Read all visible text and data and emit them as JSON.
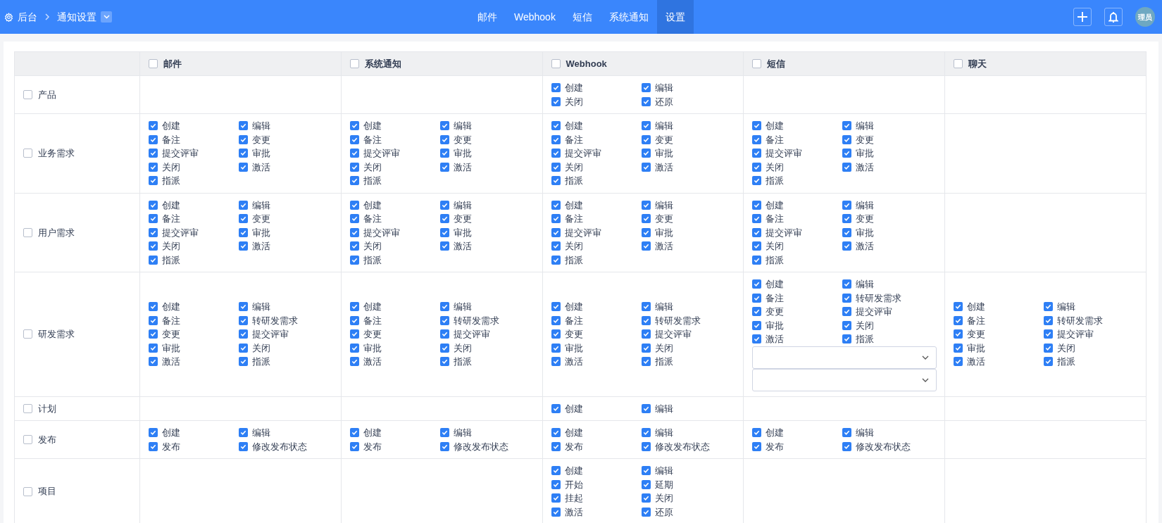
{
  "breadcrumb": {
    "root": "后台",
    "current": "通知设置"
  },
  "nav": [
    {
      "label": "邮件",
      "selected": false
    },
    {
      "label": "Webhook",
      "selected": false
    },
    {
      "label": "短信",
      "selected": false
    },
    {
      "label": "系统通知",
      "selected": false
    },
    {
      "label": "设置",
      "selected": true
    }
  ],
  "avatar": "理员",
  "table": {
    "columns": [
      {
        "label": "邮件",
        "checked": false
      },
      {
        "label": "系统通知",
        "checked": false
      },
      {
        "label": "Webhook",
        "checked": false
      },
      {
        "label": "短信",
        "checked": false
      },
      {
        "label": "聊天",
        "checked": false
      }
    ],
    "rows": [
      {
        "label": "产品",
        "checked": false,
        "cells": [
          {},
          {},
          {
            "items": [
              {
                "label": "创建",
                "checked": true
              },
              {
                "label": "编辑",
                "checked": true
              },
              {
                "label": "关闭",
                "checked": true
              },
              {
                "label": "还原",
                "checked": true
              }
            ]
          },
          {},
          {}
        ]
      },
      {
        "label": "业务需求",
        "checked": false,
        "cells": [
          {
            "items": [
              {
                "label": "创建",
                "checked": true
              },
              {
                "label": "编辑",
                "checked": true
              },
              {
                "label": "备注",
                "checked": true
              },
              {
                "label": "变更",
                "checked": true
              },
              {
                "label": "提交评审",
                "checked": true
              },
              {
                "label": "审批",
                "checked": true
              },
              {
                "label": "关闭",
                "checked": true
              },
              {
                "label": "激活",
                "checked": true
              },
              {
                "label": "指派",
                "checked": true
              }
            ]
          },
          {
            "items": [
              {
                "label": "创建",
                "checked": true
              },
              {
                "label": "编辑",
                "checked": true
              },
              {
                "label": "备注",
                "checked": true
              },
              {
                "label": "变更",
                "checked": true
              },
              {
                "label": "提交评审",
                "checked": true
              },
              {
                "label": "审批",
                "checked": true
              },
              {
                "label": "关闭",
                "checked": true
              },
              {
                "label": "激活",
                "checked": true
              },
              {
                "label": "指派",
                "checked": true
              }
            ]
          },
          {
            "items": [
              {
                "label": "创建",
                "checked": true
              },
              {
                "label": "编辑",
                "checked": true
              },
              {
                "label": "备注",
                "checked": true
              },
              {
                "label": "变更",
                "checked": true
              },
              {
                "label": "提交评审",
                "checked": true
              },
              {
                "label": "审批",
                "checked": true
              },
              {
                "label": "关闭",
                "checked": true
              },
              {
                "label": "激活",
                "checked": true
              },
              {
                "label": "指派",
                "checked": true
              }
            ]
          },
          {
            "items": [
              {
                "label": "创建",
                "checked": true
              },
              {
                "label": "编辑",
                "checked": true
              },
              {
                "label": "备注",
                "checked": true
              },
              {
                "label": "变更",
                "checked": true
              },
              {
                "label": "提交评审",
                "checked": true
              },
              {
                "label": "审批",
                "checked": true
              },
              {
                "label": "关闭",
                "checked": true
              },
              {
                "label": "激活",
                "checked": true
              },
              {
                "label": "指派",
                "checked": true
              }
            ]
          },
          {}
        ]
      },
      {
        "label": "用户需求",
        "checked": false,
        "cells": [
          {
            "items": [
              {
                "label": "创建",
                "checked": true
              },
              {
                "label": "编辑",
                "checked": true
              },
              {
                "label": "备注",
                "checked": true
              },
              {
                "label": "变更",
                "checked": true
              },
              {
                "label": "提交评审",
                "checked": true
              },
              {
                "label": "审批",
                "checked": true
              },
              {
                "label": "关闭",
                "checked": true
              },
              {
                "label": "激活",
                "checked": true
              },
              {
                "label": "指派",
                "checked": true
              }
            ]
          },
          {
            "items": [
              {
                "label": "创建",
                "checked": true
              },
              {
                "label": "编辑",
                "checked": true
              },
              {
                "label": "备注",
                "checked": true
              },
              {
                "label": "变更",
                "checked": true
              },
              {
                "label": "提交评审",
                "checked": true
              },
              {
                "label": "审批",
                "checked": true
              },
              {
                "label": "关闭",
                "checked": true
              },
              {
                "label": "激活",
                "checked": true
              },
              {
                "label": "指派",
                "checked": true
              }
            ]
          },
          {
            "items": [
              {
                "label": "创建",
                "checked": true
              },
              {
                "label": "编辑",
                "checked": true
              },
              {
                "label": "备注",
                "checked": true
              },
              {
                "label": "变更",
                "checked": true
              },
              {
                "label": "提交评审",
                "checked": true
              },
              {
                "label": "审批",
                "checked": true
              },
              {
                "label": "关闭",
                "checked": true
              },
              {
                "label": "激活",
                "checked": true
              },
              {
                "label": "指派",
                "checked": true
              }
            ]
          },
          {
            "items": [
              {
                "label": "创建",
                "checked": true
              },
              {
                "label": "编辑",
                "checked": true
              },
              {
                "label": "备注",
                "checked": true
              },
              {
                "label": "变更",
                "checked": true
              },
              {
                "label": "提交评审",
                "checked": true
              },
              {
                "label": "审批",
                "checked": true
              },
              {
                "label": "关闭",
                "checked": true
              },
              {
                "label": "激活",
                "checked": true
              },
              {
                "label": "指派",
                "checked": true
              }
            ]
          },
          {}
        ]
      },
      {
        "label": "研发需求",
        "checked": false,
        "cells": [
          {
            "items": [
              {
                "label": "创建",
                "checked": true
              },
              {
                "label": "编辑",
                "checked": true
              },
              {
                "label": "备注",
                "checked": true
              },
              {
                "label": "转研发需求",
                "checked": true
              },
              {
                "label": "变更",
                "checked": true
              },
              {
                "label": "提交评审",
                "checked": true
              },
              {
                "label": "审批",
                "checked": true
              },
              {
                "label": "关闭",
                "checked": true
              },
              {
                "label": "激活",
                "checked": true
              },
              {
                "label": "指派",
                "checked": true
              }
            ]
          },
          {
            "items": [
              {
                "label": "创建",
                "checked": true
              },
              {
                "label": "编辑",
                "checked": true
              },
              {
                "label": "备注",
                "checked": true
              },
              {
                "label": "转研发需求",
                "checked": true
              },
              {
                "label": "变更",
                "checked": true
              },
              {
                "label": "提交评审",
                "checked": true
              },
              {
                "label": "审批",
                "checked": true
              },
              {
                "label": "关闭",
                "checked": true
              },
              {
                "label": "激活",
                "checked": true
              },
              {
                "label": "指派",
                "checked": true
              }
            ]
          },
          {
            "items": [
              {
                "label": "创建",
                "checked": true
              },
              {
                "label": "编辑",
                "checked": true
              },
              {
                "label": "备注",
                "checked": true
              },
              {
                "label": "转研发需求",
                "checked": true
              },
              {
                "label": "变更",
                "checked": true
              },
              {
                "label": "提交评审",
                "checked": true
              },
              {
                "label": "审批",
                "checked": true
              },
              {
                "label": "关闭",
                "checked": true
              },
              {
                "label": "激活",
                "checked": true
              },
              {
                "label": "指派",
                "checked": true
              }
            ]
          },
          {
            "items": [
              {
                "label": "创建",
                "checked": true
              },
              {
                "label": "编辑",
                "checked": true
              },
              {
                "label": "备注",
                "checked": true
              },
              {
                "label": "转研发需求",
                "checked": true
              },
              {
                "label": "变更",
                "checked": true
              },
              {
                "label": "提交评审",
                "checked": true
              },
              {
                "label": "审批",
                "checked": true
              },
              {
                "label": "关闭",
                "checked": true
              },
              {
                "label": "激活",
                "checked": true
              },
              {
                "label": "指派",
                "checked": true
              }
            ],
            "dropdowns": [
              {
                "expanded": false
              },
              {
                "expanded": false
              }
            ]
          },
          {
            "items": [
              {
                "label": "创建",
                "checked": true
              },
              {
                "label": "编辑",
                "checked": true
              },
              {
                "label": "备注",
                "checked": true
              },
              {
                "label": "转研发需求",
                "checked": true
              },
              {
                "label": "变更",
                "checked": true
              },
              {
                "label": "提交评审",
                "checked": true
              },
              {
                "label": "审批",
                "checked": true
              },
              {
                "label": "关闭",
                "checked": true
              },
              {
                "label": "激活",
                "checked": true
              },
              {
                "label": "指派",
                "checked": true
              }
            ]
          }
        ]
      },
      {
        "label": "计划",
        "checked": false,
        "cells": [
          {},
          {},
          {
            "items": [
              {
                "label": "创建",
                "checked": true
              },
              {
                "label": "编辑",
                "checked": true
              }
            ]
          },
          {},
          {}
        ]
      },
      {
        "label": "发布",
        "checked": false,
        "cells": [
          {
            "items": [
              {
                "label": "创建",
                "checked": true
              },
              {
                "label": "编辑",
                "checked": true
              },
              {
                "label": "发布",
                "checked": true
              },
              {
                "label": "修改发布状态",
                "checked": true
              }
            ]
          },
          {
            "items": [
              {
                "label": "创建",
                "checked": true
              },
              {
                "label": "编辑",
                "checked": true
              },
              {
                "label": "发布",
                "checked": true
              },
              {
                "label": "修改发布状态",
                "checked": true
              }
            ]
          },
          {
            "items": [
              {
                "label": "创建",
                "checked": true
              },
              {
                "label": "编辑",
                "checked": true
              },
              {
                "label": "发布",
                "checked": true
              },
              {
                "label": "修改发布状态",
                "checked": true
              }
            ]
          },
          {
            "items": [
              {
                "label": "创建",
                "checked": true
              },
              {
                "label": "编辑",
                "checked": true
              },
              {
                "label": "发布",
                "checked": true
              },
              {
                "label": "修改发布状态",
                "checked": true
              }
            ]
          },
          {}
        ]
      },
      {
        "label": "项目",
        "checked": false,
        "cells": [
          {},
          {},
          {
            "items": [
              {
                "label": "创建",
                "checked": true
              },
              {
                "label": "编辑",
                "checked": true
              },
              {
                "label": "开始",
                "checked": true
              },
              {
                "label": "延期",
                "checked": true
              },
              {
                "label": "挂起",
                "checked": true
              },
              {
                "label": "关闭",
                "checked": true
              },
              {
                "label": "激活",
                "checked": true
              },
              {
                "label": "还原",
                "checked": true
              }
            ]
          },
          {},
          {}
        ]
      }
    ]
  }
}
